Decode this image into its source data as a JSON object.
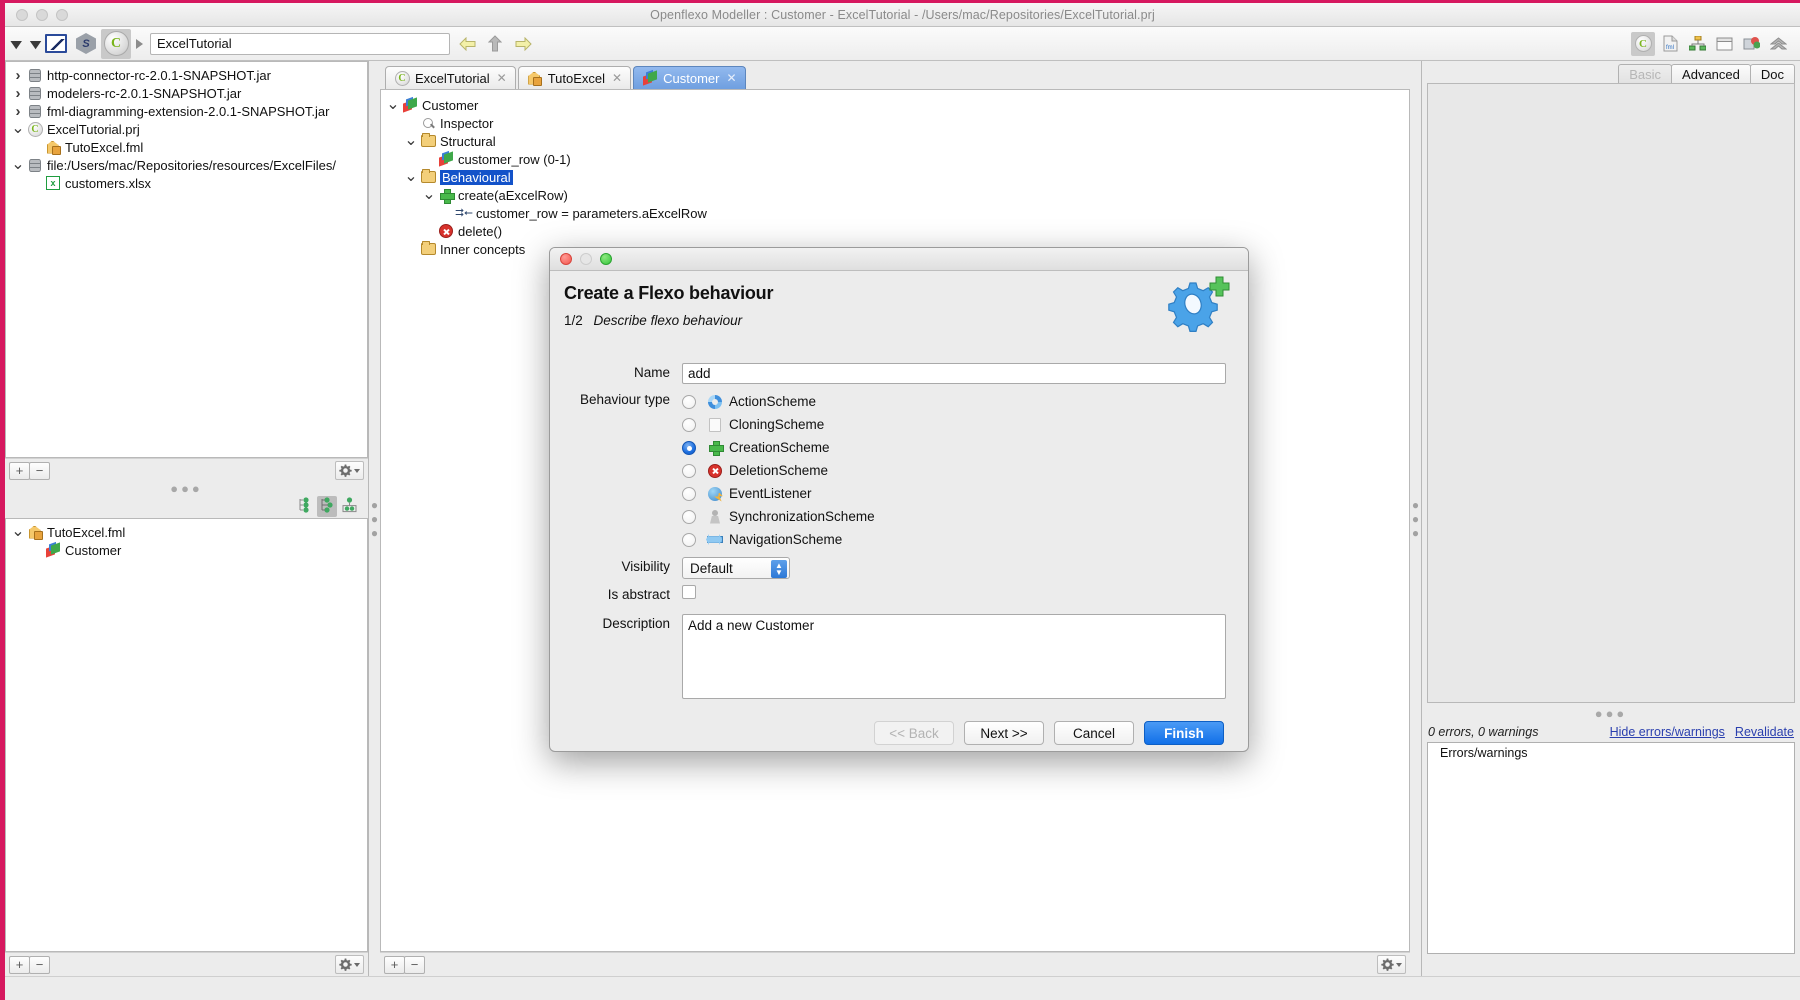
{
  "window": {
    "title": "Openflexo Modeller : Customer - ExcelTutorial - /Users/mac/Repositories/ExcelTutorial.prj"
  },
  "toolbar": {
    "path_value": "ExcelTutorial",
    "icons": [
      "double-chevron-down-icon",
      "pencil-icon",
      "cube-icon",
      "openflexo-icon"
    ],
    "nav_back": "back-arrow-icon",
    "nav_up": "up-arrow-icon",
    "nav_forward": "forward-arrow-icon",
    "right_icons": [
      "project-icon",
      "fml-file-icon",
      "diagram-icon",
      "window-icon",
      "resource-icon",
      "collapse-icon"
    ]
  },
  "left_panel": {
    "tree": [
      {
        "indent": 1,
        "twisty": "collapsed",
        "icon": "jar-icon",
        "label": "http-connector-rc-2.0.1-SNAPSHOT.jar"
      },
      {
        "indent": 1,
        "twisty": "collapsed",
        "icon": "jar-icon",
        "label": "modelers-rc-2.0.1-SNAPSHOT.jar"
      },
      {
        "indent": 1,
        "twisty": "collapsed",
        "icon": "jar-icon",
        "label": "fml-diagramming-extension-2.0.1-SNAPSHOT.jar"
      },
      {
        "indent": 1,
        "twisty": "expanded",
        "icon": "project-icon",
        "label": "ExcelTutorial.prj"
      },
      {
        "indent": 2,
        "twisty": "none",
        "icon": "fml-icon",
        "label": "TutoExcel.fml"
      },
      {
        "indent": 1,
        "twisty": "expanded",
        "icon": "jar-icon",
        "label": "file:/Users/mac/Repositories/resources/ExcelFiles/"
      },
      {
        "indent": 2,
        "twisty": "none",
        "icon": "xlsx-icon",
        "label": "customers.xlsx"
      }
    ],
    "footer": {
      "add": "+",
      "remove": "−",
      "gear": "gear-icon"
    },
    "view_icons": [
      "tree-view-icon",
      "tree-view-selected-icon",
      "grid-view-icon"
    ],
    "tree2": [
      {
        "indent": 1,
        "twisty": "expanded",
        "icon": "fml-icon",
        "label": "TutoExcel.fml"
      },
      {
        "indent": 2,
        "twisty": "none",
        "icon": "virtual-model-icon",
        "label": "Customer"
      }
    ],
    "footer2": {
      "add": "+",
      "remove": "−",
      "gear": "gear-icon"
    }
  },
  "center_panel": {
    "tabs": [
      {
        "label": "ExcelTutorial",
        "icon": "project-icon",
        "close": "✕",
        "active": false
      },
      {
        "label": "TutoExcel",
        "icon": "fml-icon",
        "close": "✕",
        "active": false
      },
      {
        "label": "Customer",
        "icon": "virtual-model-icon",
        "close": "✕",
        "active": true
      }
    ],
    "tree": [
      {
        "indent": 1,
        "twisty": "expanded",
        "icon": "virtual-model-icon",
        "label": "Customer",
        "selected": false
      },
      {
        "indent": 2,
        "twisty": "none",
        "icon": "inspector-icon",
        "label": "Inspector",
        "selected": false
      },
      {
        "indent": 2,
        "twisty": "expanded",
        "icon": "folder-icon",
        "label": "Structural",
        "selected": false
      },
      {
        "indent": 3,
        "twisty": "none",
        "icon": "virtual-model-icon",
        "label": "customer_row (0-1)",
        "selected": false
      },
      {
        "indent": 2,
        "twisty": "expanded",
        "icon": "folder-icon",
        "label": "Behavioural",
        "selected": true
      },
      {
        "indent": 3,
        "twisty": "expanded",
        "icon": "creation-icon",
        "label": "create(aExcelRow)",
        "selected": false
      },
      {
        "indent": 4,
        "twisty": "none",
        "icon": "assignment-icon",
        "label": "customer_row = parameters.aExcelRow",
        "selected": false
      },
      {
        "indent": 3,
        "twisty": "none",
        "icon": "deletion-icon",
        "label": "delete()",
        "selected": false
      },
      {
        "indent": 2,
        "twisty": "none",
        "icon": "folder-icon",
        "label": "Inner concepts",
        "selected": false
      }
    ],
    "footer": {
      "add": "+",
      "remove": "−",
      "gear": "gear-icon"
    }
  },
  "right_panel": {
    "tabs": [
      {
        "label": "Basic",
        "disabled": true
      },
      {
        "label": "Advanced",
        "disabled": false
      },
      {
        "label": "Doc",
        "disabled": false
      }
    ],
    "errors": {
      "count_text": "0 errors, 0 warnings",
      "hide_link": "Hide errors/warnings",
      "revalidate_link": "Revalidate",
      "list_title": "Errors/warnings"
    }
  },
  "dialog": {
    "title_buttons": [
      "close",
      "minimize",
      "zoom"
    ],
    "heading": "Create a Flexo behaviour",
    "step": "1/2",
    "step_desc": "Describe flexo behaviour",
    "icon": "gear-add-icon",
    "fields": {
      "name_label": "Name",
      "name_value": "add",
      "behaviour_type_label": "Behaviour type",
      "visibility_label": "Visibility",
      "visibility_value": "Default",
      "is_abstract_label": "Is abstract",
      "is_abstract_checked": false,
      "description_label": "Description",
      "description_value": "Add a new Customer"
    },
    "behaviour_types": [
      {
        "label": "ActionScheme",
        "icon": "action-scheme-icon",
        "selected": false
      },
      {
        "label": "CloningScheme",
        "icon": "cloning-scheme-icon",
        "selected": false
      },
      {
        "label": "CreationScheme",
        "icon": "creation-scheme-icon",
        "selected": true
      },
      {
        "label": "DeletionScheme",
        "icon": "deletion-scheme-icon",
        "selected": false
      },
      {
        "label": "EventListener",
        "icon": "event-listener-icon",
        "selected": false
      },
      {
        "label": "SynchronizationScheme",
        "icon": "synchronization-scheme-icon",
        "selected": false
      },
      {
        "label": "NavigationScheme",
        "icon": "navigation-scheme-icon",
        "selected": false
      }
    ],
    "buttons": {
      "back": "<< Back",
      "next": "Next >>",
      "cancel": "Cancel",
      "finish": "Finish"
    }
  },
  "colors": {
    "accent_pink": "#d6185f",
    "selection_blue": "#1352c9",
    "tab_active": "#6f9fe0",
    "primary_button": "#1170e8",
    "link": "#2a3fae"
  }
}
